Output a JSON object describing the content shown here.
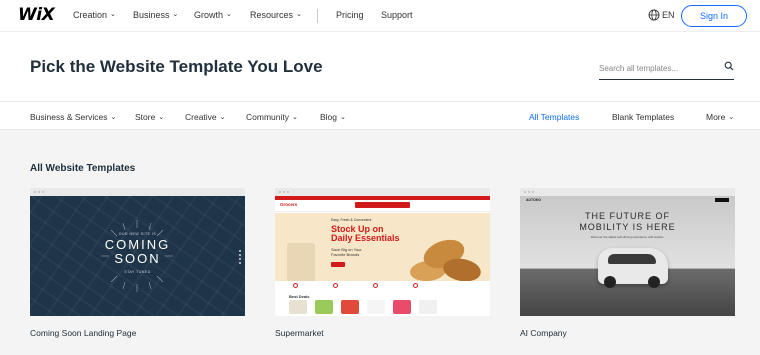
{
  "brand": {
    "logo": "WiX",
    "accent": "#116dff"
  },
  "topnav": {
    "items": [
      {
        "label": "Creation",
        "has_menu": true
      },
      {
        "label": "Business",
        "has_menu": true
      },
      {
        "label": "Growth",
        "has_menu": true
      },
      {
        "label": "Resources",
        "has_menu": true
      },
      {
        "label": "Pricing",
        "has_menu": false
      },
      {
        "label": "Support",
        "has_menu": false
      }
    ],
    "language": "EN",
    "signin_label": "Sign In"
  },
  "header": {
    "title": "Pick the Website Template You Love",
    "search_placeholder": "Search all templates..."
  },
  "categories": {
    "left": [
      {
        "label": "Business & Services"
      },
      {
        "label": "Store"
      },
      {
        "label": "Creative"
      },
      {
        "label": "Community"
      },
      {
        "label": "Blog"
      }
    ],
    "right": [
      {
        "label": "All Templates",
        "active": true
      },
      {
        "label": "Blank Templates",
        "active": false
      },
      {
        "label": "More",
        "active": false
      }
    ]
  },
  "gallery": {
    "section_title": "All Website Templates",
    "cards": [
      {
        "name": "Coming Soon Landing Page",
        "thumb": {
          "kicker": "OUR NEW SITE IS",
          "headline_1": "COMING",
          "headline_2": "SOON",
          "footer": "STAY TUNED"
        }
      },
      {
        "name": "Supermarket",
        "thumb": {
          "logo": "Grocers",
          "kicker": "Easy, Fresh & Convenient",
          "headline_1": "Stock Up on",
          "headline_2": "Daily Essentials",
          "sub_1": "Save Big on Your",
          "sub_2": "Favorite Brands",
          "section": "Best Deals"
        }
      },
      {
        "name": "AI Company",
        "thumb": {
          "logo": "AUTOKO",
          "headline_1": "THE FUTURE OF",
          "headline_2": "MOBILITY IS HERE",
          "sub": "Discover the safest self-driving experience with Autoko."
        }
      }
    ]
  }
}
